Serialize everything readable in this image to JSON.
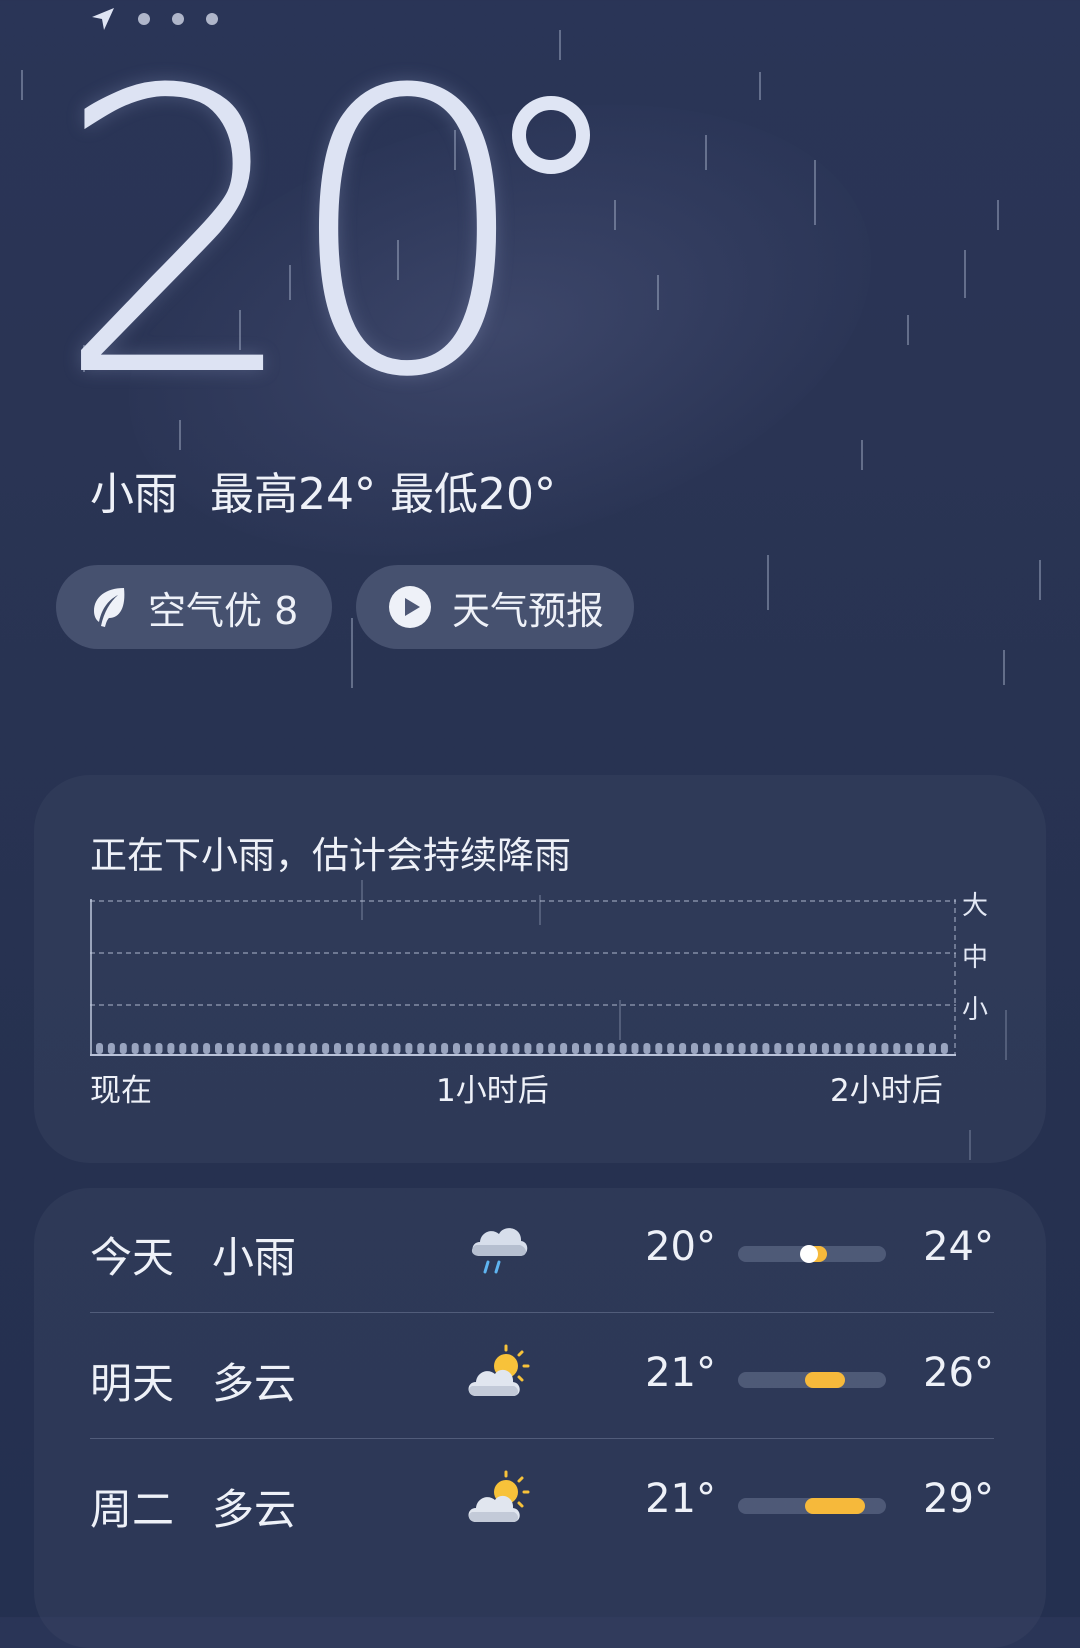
{
  "current": {
    "temperature": "20",
    "summary_condition": "小雨",
    "summary_range": "最高24° 最低20°"
  },
  "chips": {
    "air_quality": "空气优 8",
    "forecast_video": "天气预报"
  },
  "precipitation": {
    "title": "正在下小雨，估计会持续降雨",
    "levels": [
      "大",
      "中",
      "小"
    ],
    "times": [
      "现在",
      "1小时后",
      "2小时后"
    ]
  },
  "daily": [
    {
      "day": "今天",
      "condition": "小雨",
      "icon": "rain-cloud-icon",
      "low": "20°",
      "high": "24°",
      "range_start": 0.45,
      "range_end": 0.6,
      "current_marker": 0.48
    },
    {
      "day": "明天",
      "condition": "多云",
      "icon": "partly-cloudy-icon",
      "low": "21°",
      "high": "26°",
      "range_start": 0.45,
      "range_end": 0.72
    },
    {
      "day": "周二",
      "condition": "多云",
      "icon": "partly-cloudy-icon",
      "low": "21°",
      "high": "29°",
      "range_start": 0.45,
      "range_end": 0.86
    }
  ],
  "colors": {
    "background": "#283352",
    "range_fill": "#f6b93b",
    "card": "#3c4664"
  }
}
